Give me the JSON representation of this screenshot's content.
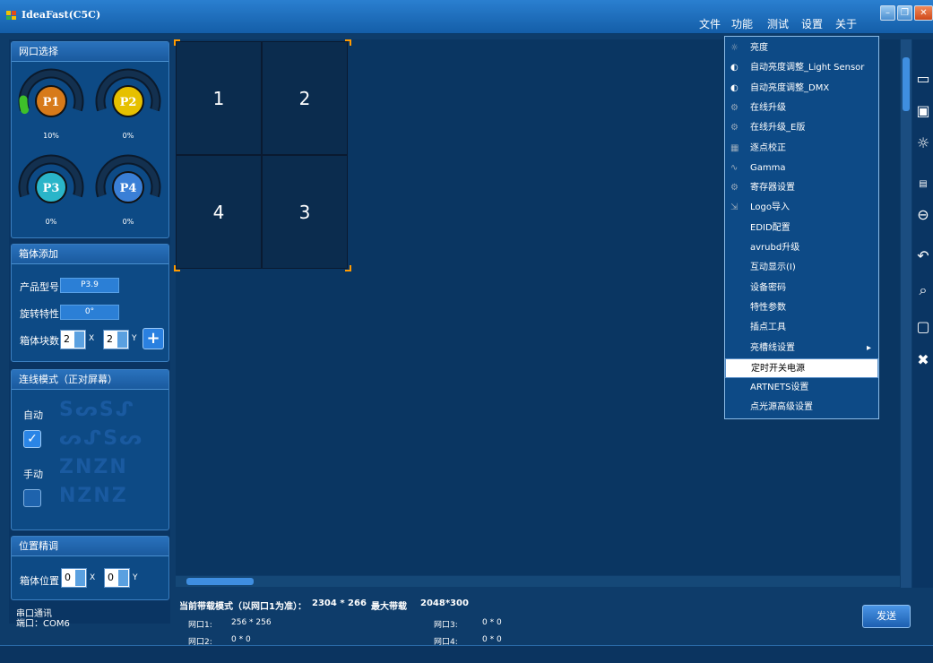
{
  "app": {
    "title": "IdeaFast(C5C)",
    "menus": [
      "文件",
      "功能",
      "测试",
      "设置",
      "关于"
    ]
  },
  "ports": {
    "header": "网口选择",
    "items": [
      {
        "label": "P1",
        "value": "10%",
        "color": "#d77a1a",
        "fill": 0.1
      },
      {
        "label": "P2",
        "value": "0%",
        "color": "#e6c000",
        "fill": 0
      },
      {
        "label": "P3",
        "value": "0%",
        "color": "#2ab5c9",
        "fill": 0
      },
      {
        "label": "P4",
        "value": "0%",
        "color": "#3a7fd6",
        "fill": 0
      }
    ]
  },
  "cabinet": {
    "header": "箱体添加",
    "model_label": "产品型号",
    "model_value": "P3.9",
    "rotate_label": "旋转特性",
    "rotate_value": "0°",
    "count_label": "箱体块数",
    "count_x": "2",
    "count_y": "2",
    "x_label": "X",
    "y_label": "Y"
  },
  "wiring": {
    "header": "连线模式（正对屏幕）",
    "auto_label": "自动",
    "manual_label": "手动",
    "auto_checked": true,
    "manual_checked": false
  },
  "position": {
    "header": "位置精调",
    "label": "箱体位置",
    "x": "0",
    "y": "0",
    "x_label": "X",
    "y_label": "Y"
  },
  "serial": {
    "title": "串口通讯",
    "port": "端口：COM6"
  },
  "grid": {
    "cells": [
      "1",
      "2",
      "4",
      "3"
    ]
  },
  "dropdown": {
    "items": [
      {
        "label": "亮度",
        "icon": "sun-icon"
      },
      {
        "label": "自动亮度调整_Light Sensor",
        "icon": "half-circle-icon"
      },
      {
        "label": "自动亮度调整_DMX",
        "icon": "half-circle-icon"
      },
      {
        "label": "在线升级",
        "icon": "gear-icon"
      },
      {
        "label": "在线升级_E版",
        "icon": "gear-icon"
      },
      {
        "label": "逐点校正",
        "icon": "grid-icon"
      },
      {
        "label": "Gamma",
        "icon": "curve-icon"
      },
      {
        "label": "寄存器设置",
        "icon": "gear-icon"
      },
      {
        "label": "Logo导入",
        "icon": "import-icon"
      },
      {
        "label": "EDID配置",
        "icon": ""
      },
      {
        "label": "avrubd升级",
        "icon": ""
      },
      {
        "label": "互动显示(I)",
        "icon": ""
      },
      {
        "label": "设备密码",
        "icon": ""
      },
      {
        "label": "特性参数",
        "icon": ""
      },
      {
        "label": "插点工具",
        "icon": ""
      },
      {
        "label": "亮槽线设置",
        "icon": "",
        "submenu": true
      },
      {
        "label": "定时开关电源",
        "icon": "",
        "highlighted": true
      },
      {
        "label": "ARTNETS设置",
        "icon": ""
      },
      {
        "label": "点光源高级设置",
        "icon": ""
      }
    ]
  },
  "bottom": {
    "mode_label": "当前带载模式（以网口1为准）：",
    "mode_value": "2304 * 266",
    "max_label": "最大带载",
    "max_value": "2048*300",
    "ports": [
      {
        "label": "网口1:",
        "value": "256 * 256"
      },
      {
        "label": "网口2:",
        "value": "0 * 0"
      },
      {
        "label": "网口3:",
        "value": "0 * 0"
      },
      {
        "label": "网口4:",
        "value": "0 * 0"
      }
    ],
    "send": "发送"
  }
}
